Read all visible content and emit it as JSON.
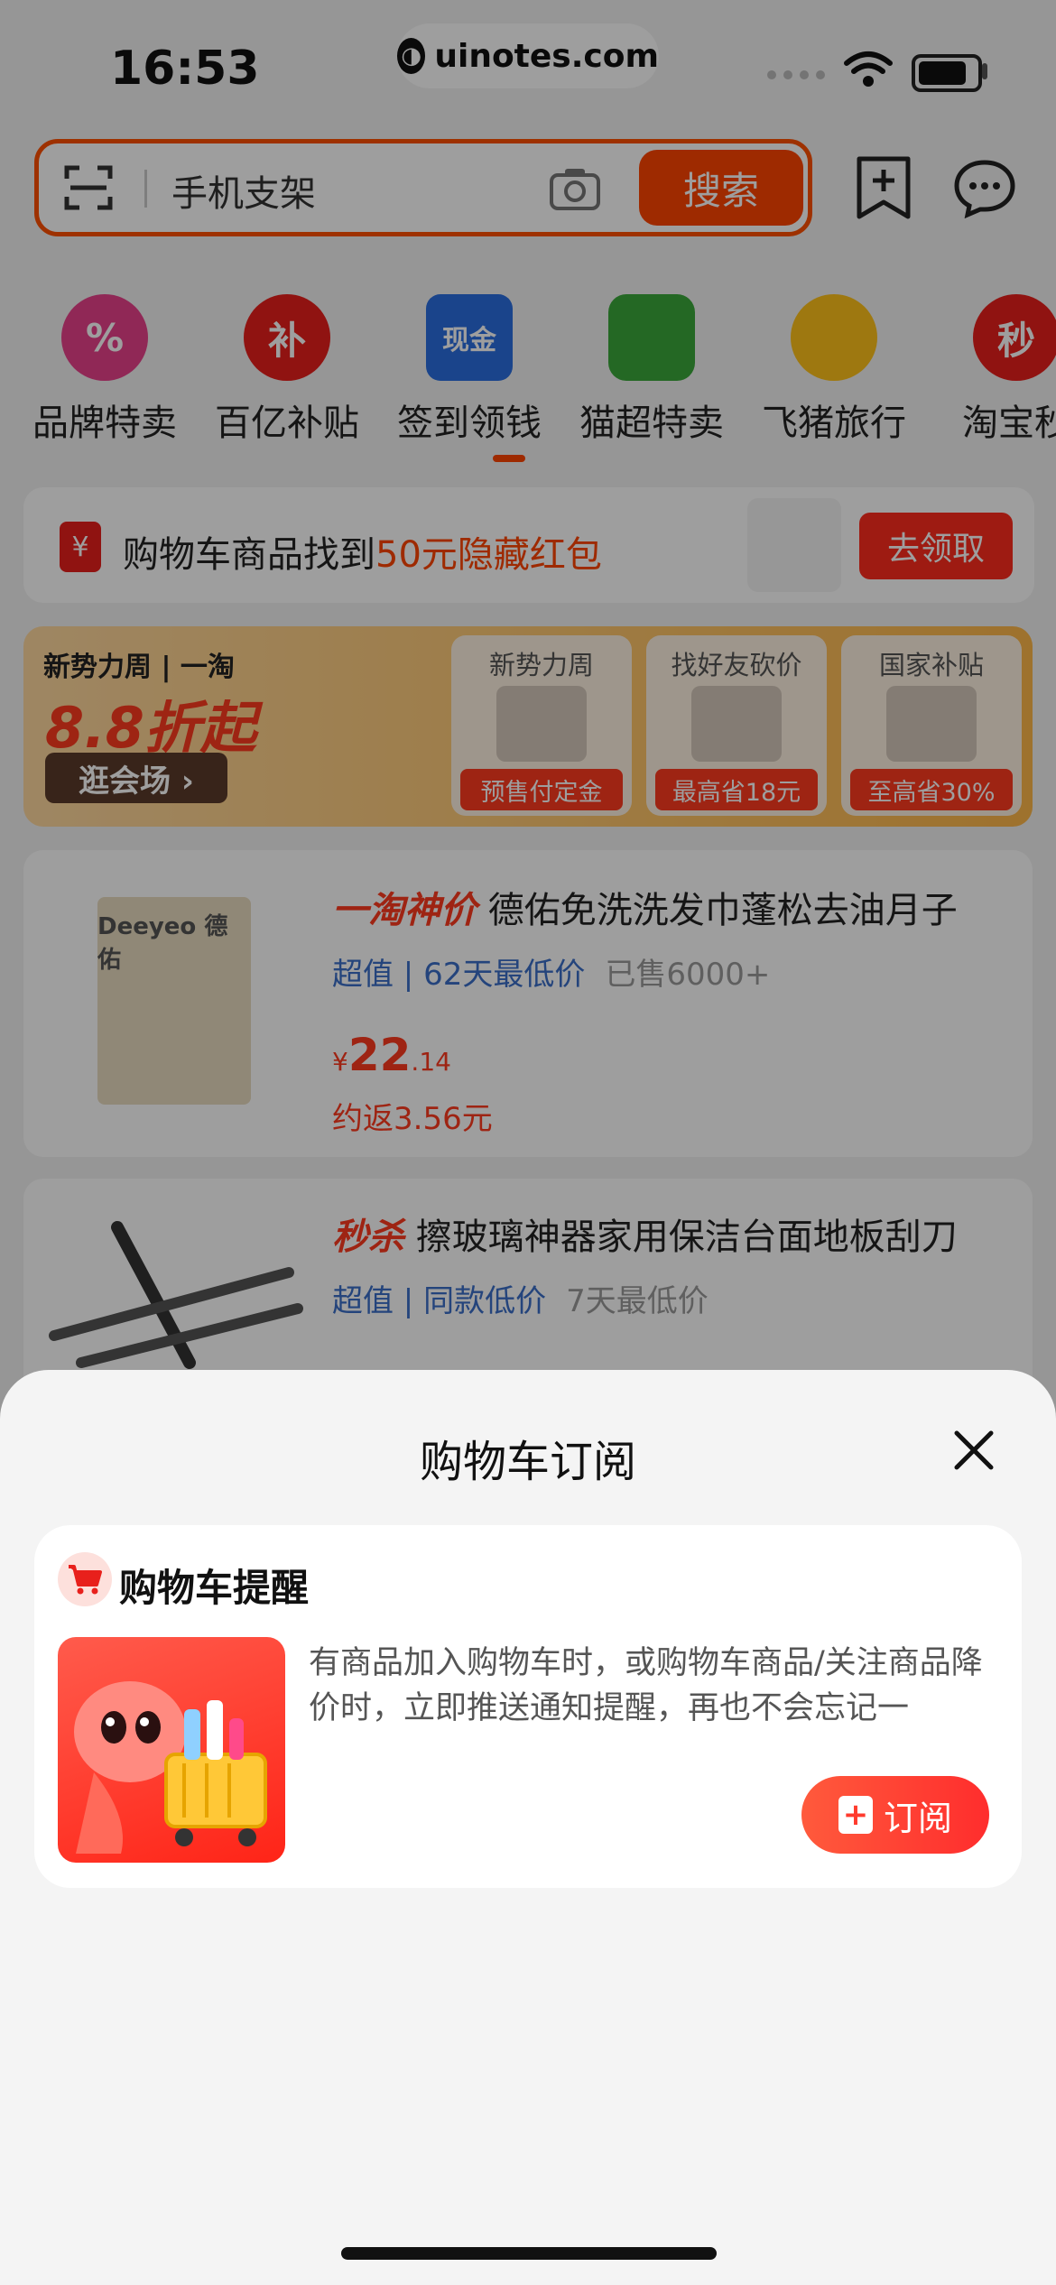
{
  "status_bar": {
    "time": "16:53"
  },
  "watermark": {
    "text": "uinotes.com"
  },
  "search": {
    "query": "手机支架",
    "button": "搜索"
  },
  "categories": [
    {
      "label": "品牌特卖",
      "icon": "percent-flower-icon",
      "color": "#e8418c",
      "glyph": "%"
    },
    {
      "label": "百亿补贴",
      "icon": "subsidy-icon",
      "color": "#e8201c",
      "glyph": "补"
    },
    {
      "label": "签到领钱",
      "icon": "cash-icon",
      "color": "#2a6fe0",
      "glyph": "现金"
    },
    {
      "label": "猫超特卖",
      "icon": "cat-market-icon",
      "color": "#3aa83a",
      "glyph": ""
    },
    {
      "label": "飞猪旅行",
      "icon": "fliggy-icon",
      "color": "#ffc21a",
      "glyph": ""
    },
    {
      "label": "淘宝秒",
      "icon": "flash-sale-icon",
      "color": "#e8201c",
      "glyph": "秒"
    }
  ],
  "red_packet": {
    "text_prefix": "购物车商品找到",
    "highlight": "50元隐藏红包",
    "button": "去领取",
    "icon_glyph": "¥"
  },
  "promo": {
    "brand": "新势力周 | 一淘",
    "headline": "8.8折起",
    "enter": "逛会场 ›",
    "cards": [
      {
        "title": "新势力周",
        "tag": "预售付定金"
      },
      {
        "title": "找好友砍价",
        "tag": "最高省18元"
      },
      {
        "title": "国家补贴",
        "tag": "至高省30%"
      }
    ]
  },
  "products": [
    {
      "tag": "一淘神价",
      "title": "德佑免洗洗发巾蓬松去油月子",
      "meta_blue": "超值 | 62天最低价",
      "meta_grey": "已售6000+",
      "currency": "¥",
      "price_int": "22",
      "price_dec": ".14",
      "rebate": "约返3.56元",
      "image_text": "Deeyeo 德佑"
    },
    {
      "tag": "秒杀",
      "title": "擦玻璃神器家用保洁台面地板刮刀",
      "meta_blue": "超值 | 同款低价",
      "meta_grey": "7天最低价"
    }
  ],
  "sheet": {
    "title": "购物车订阅",
    "card_title": "购物车提醒",
    "description": "有商品加入购物车时，或购物车商品/关注商品降价时，立即推送通知提醒，再也不会忘记一",
    "subscribe_button": "订阅",
    "subscribe_icon_glyph": "+"
  }
}
